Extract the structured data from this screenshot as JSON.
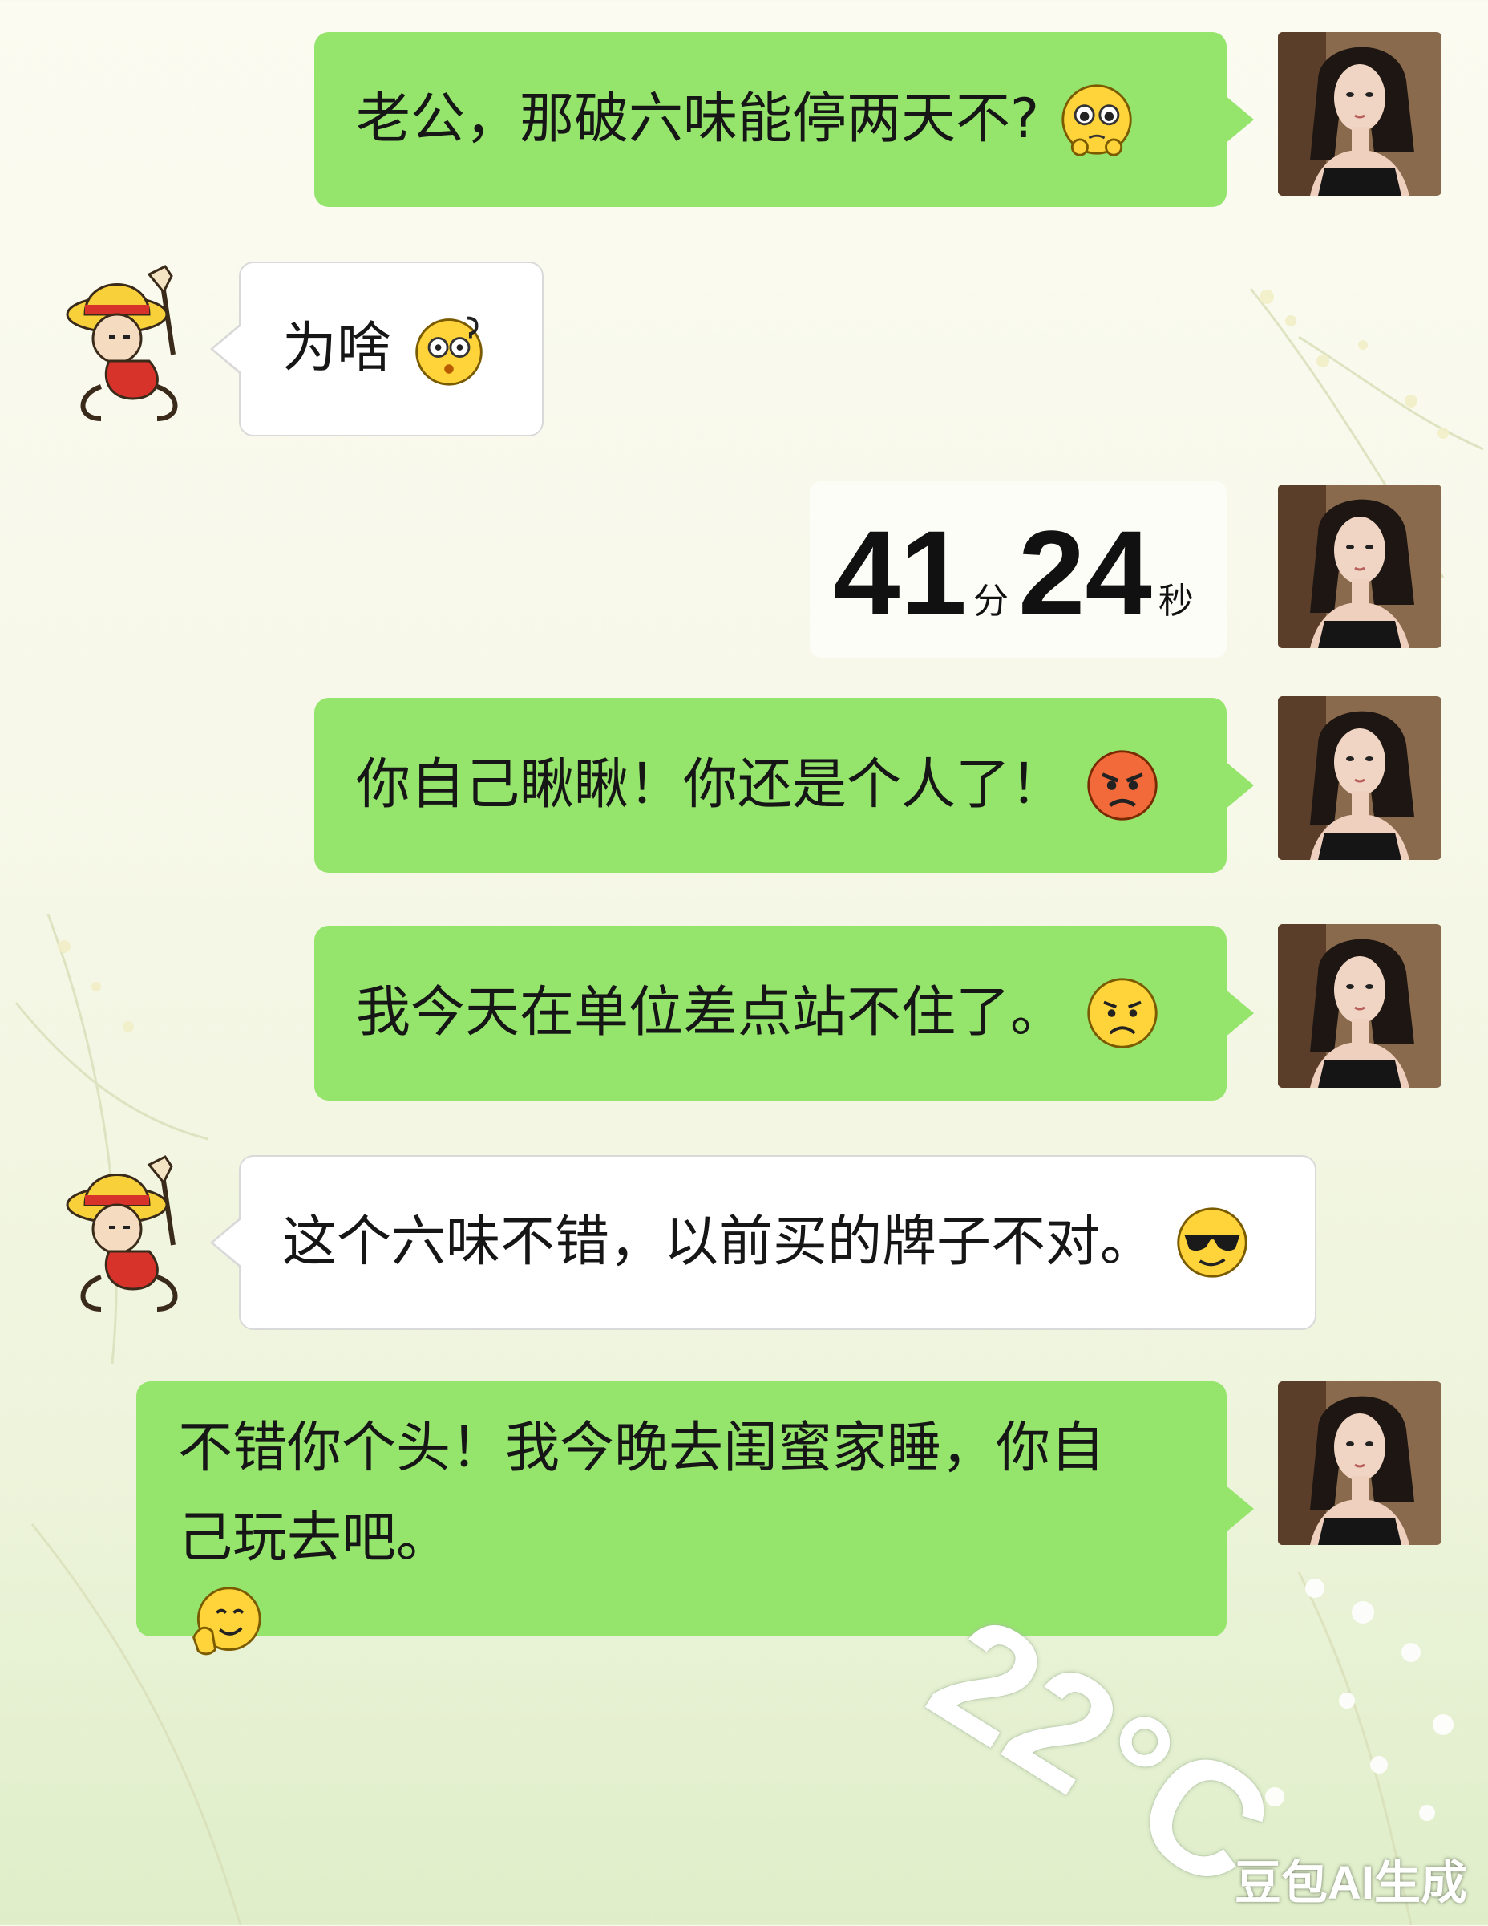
{
  "messages": [
    {
      "side": "right",
      "text": "老公，那破六味能停两天不?",
      "emoji": "pleading-face-icon"
    },
    {
      "side": "left",
      "text": "为啥",
      "emoji": "confused-face-icon"
    },
    {
      "side": "right",
      "type": "timer",
      "minutes": "41",
      "min_unit": "分",
      "seconds": "24",
      "sec_unit": "秒"
    },
    {
      "side": "right",
      "text": "你自己瞅瞅！你还是个人了！",
      "emoji": "angry-face-icon"
    },
    {
      "side": "right",
      "text": "我今天在单位差点站不住了。",
      "emoji": "sad-face-icon"
    },
    {
      "side": "left",
      "text": "这个六味不错，以前买的牌子不对。",
      "emoji": "sunglasses-face-icon"
    },
    {
      "side": "right",
      "text": "不错你个头！我今晚去闺蜜家睡，你自己玩去吧。",
      "emoji": "face-with-hand-icon"
    }
  ],
  "watermark": {
    "temperature": "22°C",
    "brand": "豆包AI生成"
  },
  "colors": {
    "bubble_green": "#95e46c",
    "bubble_white": "#ffffff",
    "background": "#f7f8e9"
  }
}
